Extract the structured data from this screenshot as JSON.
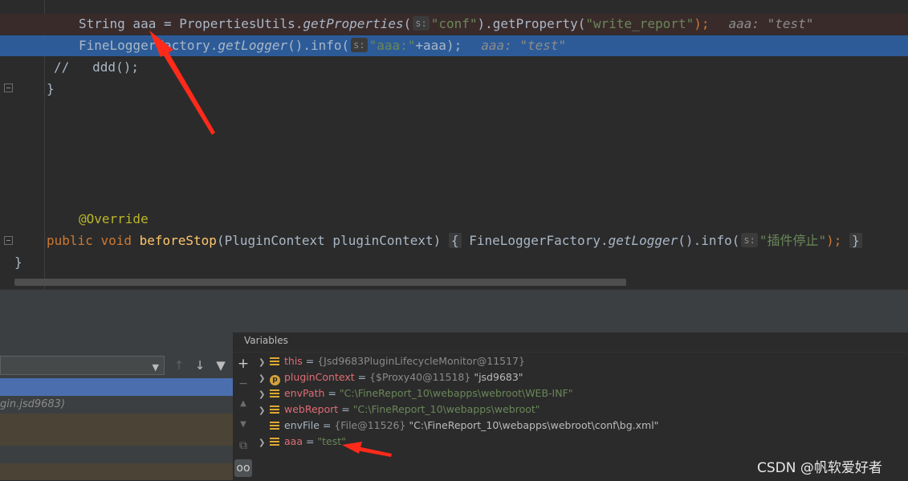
{
  "editor": {
    "line1": {
      "p1": "String aaa = PropertiesUtils.",
      "p2": "getProperties",
      "p3": "(",
      "hint": "s:",
      "p4": "\"conf\"",
      "p5": ").getProperty(",
      "p6": "\"write_report\"",
      "p7": ");",
      "inline": "aaa: \"test\""
    },
    "line2": {
      "p1": "FineLoggerFactory.",
      "p2": "getLogger",
      "p3": "().info(",
      "hint": "s:",
      "p4": "\"aaa:\"",
      "p5": "+aaa);",
      "inline": "aaa: \"test\""
    },
    "line3": "//   ddd();",
    "line4": "}",
    "annotation": "@Override",
    "line6": {
      "k1": "public",
      "k2": "void",
      "fn": "beforeStop",
      "p1": "(PluginContext pluginContext) ",
      "b1": "{",
      "p2": " FineLoggerFactory.",
      "p3": "getLogger",
      "p4": "().info(",
      "hint": "s:",
      "p5": "\"插件停止\"",
      "p6": ");",
      "b2": "}"
    },
    "line7": "}"
  },
  "frames": {
    "row_label": "gin.jsd9683)"
  },
  "variables": {
    "title": "Variables",
    "items": [
      {
        "name": "this",
        "eq": " = ",
        "type": "{Jsd9683PluginLifecycleMonitor@11517}",
        "value": ""
      },
      {
        "name": "pluginContext",
        "eq": " = ",
        "type": "{$Proxy40@11518}",
        "value": " \"jsd9683\""
      },
      {
        "name": "envPath",
        "eq": " = ",
        "type": "",
        "value": "\"C:\\FineReport_10\\webapps\\webroot\\WEB-INF\""
      },
      {
        "name": "webReport",
        "eq": " = ",
        "type": "",
        "value": "\"C:\\FineReport_10\\webapps\\webroot\""
      },
      {
        "name": "envFile",
        "eq": " = ",
        "type": "{File@11526}",
        "value": " \"C:\\FineReport_10\\webapps\\webroot\\conf\\bg.xml\""
      },
      {
        "name": "aaa",
        "eq": " = ",
        "type": "",
        "value": "\"test\""
      }
    ]
  },
  "watermark": "CSDN @帆软爱好者",
  "colors": {
    "editor_bg": "#2b2b2b",
    "execution_line": "#2d5b98",
    "breakpoint_line": "#3a2b2b",
    "arrow": "#ff2a1a"
  }
}
